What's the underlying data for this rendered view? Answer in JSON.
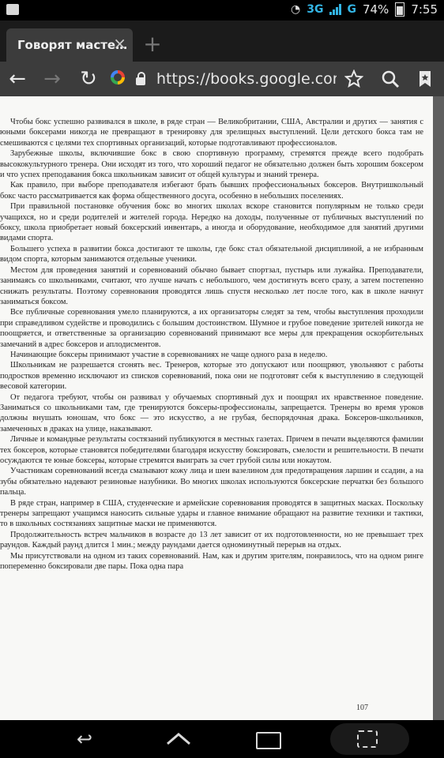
{
  "status_bar": {
    "network": "3G",
    "network2": "G",
    "battery": "74%",
    "time": "7:55"
  },
  "tab": {
    "title": "Говорят масте…",
    "close_glyph": "×",
    "new_tab_glyph": "+"
  },
  "toolbar": {
    "back_glyph": "←",
    "forward_glyph": "→",
    "reload_glyph": "↻",
    "url": "https://books.google.com.ua/b"
  },
  "page": {
    "paragraphs": [
      "Чтобы бокс успешно развивался в школе, в ряде стран — Великобритании, США, Австралии и других — занятия с юными боксерами никогда не превращают в тренировку для зрелищных выступлений. Цели детского бокса там не смешиваются с целями тех спортивных организаций, которые подготавливают профессионалов.",
      "Зарубежные школы, включившие бокс в свою спортивную программу, стремятся прежде всего подобрать высококультурного тренера. Они исходят из того, что хороший педагог не обязательно должен быть хорошим боксером и что успех преподавания бокса школьникам зависит от общей культуры и знаний тренера.",
      "Как правило, при выборе преподавателя избегают брать бывших профессиональных боксеров. Внутришкольный бокс часто рассматривается как форма общественного досуга, особенно в небольших поселениях.",
      "При правильной постановке обучения бокс во многих школах вскоре становится популярным не только среди учащихся, но и среди родителей и жителей города. Нередко на доходы, полученные от публичных выступлений по боксу, школа приобретает новый боксерский инвентарь, а иногда и оборудование, необходимое для занятий другими видами спорта.",
      "Большего успеха в развитии бокса достигают те школы, где бокс стал обязательной дисциплиной, а не избранным видом спорта, которым занимаются отдельные ученики.",
      "Местом для проведения занятий и соревнований обычно бывает спортзал, пустырь или лужайка. Преподаватели, занимаясь со школьниками, считают, что лучше начать с небольшого, чем достигнуть всего сразу, а затем постепенно снижать результаты. Поэтому соревнования проводятся лишь спустя несколько лет после того, как в школе начнут заниматься боксом.",
      "Все публичные соревнования умело планируются, а их организаторы следят за тем, чтобы выступления проходили при справедливом судействе и проводились с большим достоинством. Шумное и грубое поведение зрителей никогда не поощряется, и ответственные за организацию соревнований принимают все меры для прекращения оскорбительных замечаний в адрес боксеров и аплодисментов.",
      "Начинающие боксеры принимают участие в соревнованиях не чаще одного раза в неделю.",
      "Школьникам не разрешается сгонять вес. Тренеров, которые это допускают или поощряют, увольняют с работы подростков временно исключают из списков соревнований, пока они не подготовят себя к выступлению в следующей весовой категории.",
      "От педагога требуют, чтобы он развивал у обучаемых спортивный дух и поощрял их нравственное поведение. Заниматься со школьниками там, где тренируются боксеры-профессионалы, запрещается. Тренеры во время уроков должны внушать юношам, что бокс — это искусство, а не грубая, беспорядочная драка. Боксеров-школьников, замеченных в драках на улице, наказывают.",
      "Личные и командные результаты состязаний публикуются в местных газетах. Причем в печати выделяются фамилии тех боксеров, которые становятся победителями благодаря искусству боксировать, смелости и решительности. В печати осуждаются те юные боксеры, которые стремятся выиграть за счет грубой силы или нокаутом.",
      "Участникам соревнований всегда смазывают кожу лица и шеи вазелином для предотвращения ларшин и ссадин, а на зубы обязательно надевают резиновые назубники. Во многих школах используются боксерские перчатки без большого пальца.",
      "В ряде стран, например в США, студенческие и армейские соревнования проводятся в защитных масках. Поскольку тренеры запрещают учащимся наносить сильные удары и главное внимание обращают на развитие техники и тактики, то в школьных состязаниях защитные маски не применяются.",
      "Продолжительность встреч мальчиков в возрасте до 13 лет зависит от их подготовленности, но не превышает трех раундов. Каждый раунд длится 1 мин.; между раундами дается одноминутный перерыв на отдых.",
      "Мы присутствовали на одном из таких соревнований. Нам, как и другим зрителям, понравилось, что на одном ринге попеременно боксировали две пары. Пока одна пара"
    ],
    "page_number": "107"
  },
  "nav": {
    "back_glyph": "↩",
    "home_glyph": "⌂"
  },
  "colors": {
    "highlight": "#fff59d",
    "page": "#f8f8f6",
    "toolbar": "#3c3c3c"
  }
}
